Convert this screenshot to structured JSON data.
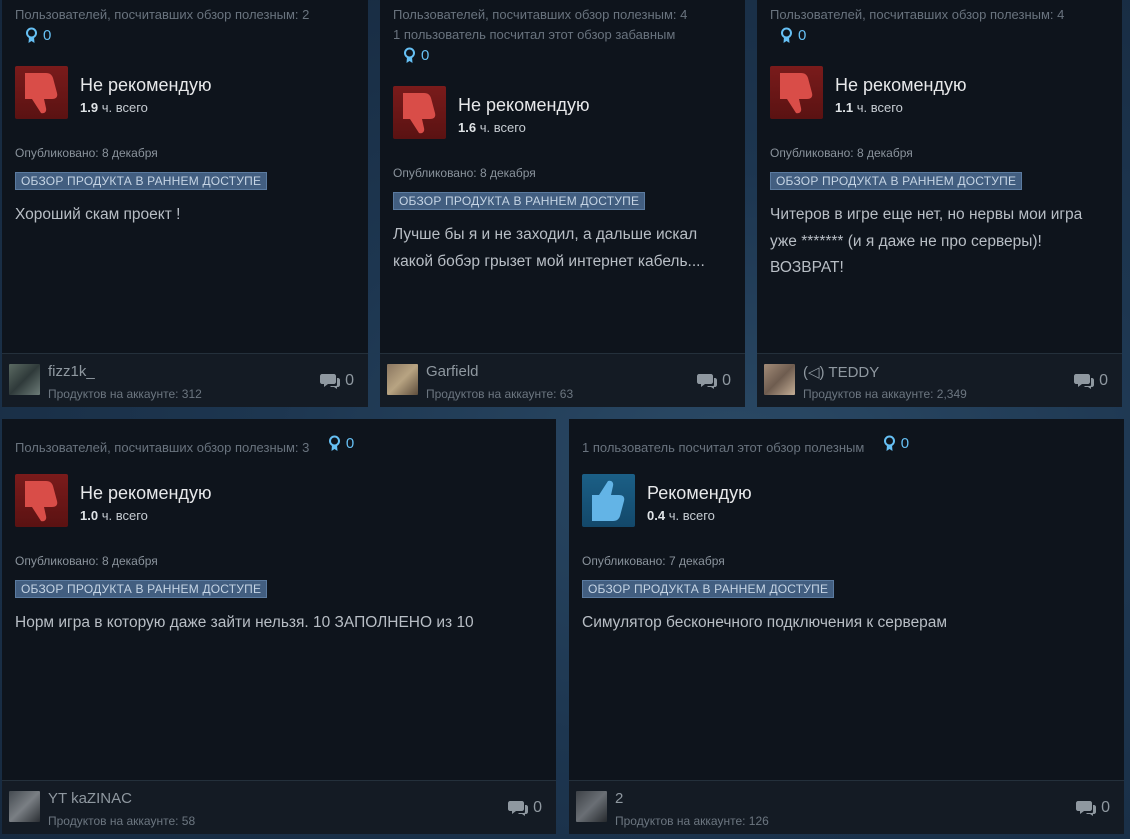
{
  "labels": {
    "posted_prefix": "Опубликовано: ",
    "hours_suffix": "ч. всего",
    "products_prefix": "Продуктов на аккаунте: ",
    "early_access": "ОБЗОР ПРОДУКТА В РАННЕМ ДОСТУПЕ"
  },
  "colors": {
    "card_bg": "#0e141c",
    "accent_blue": "#66c0f4",
    "thumb_down": "#d9534f",
    "thumb_up": "#63b4e6",
    "ea_badge": "#425e80"
  },
  "reviews": [
    {
      "helpful": "Пользователей, посчитавших обзор полезным: 2",
      "funny": "",
      "awards": "0",
      "verdict": "Не рекомендую",
      "recommended": false,
      "hours": "1.9",
      "posted": "8 декабря",
      "text": "Хороший скам проект !",
      "user": "fizz1k_",
      "products": "312",
      "comments": "0",
      "icon": "thumbs-down-icon"
    },
    {
      "helpful": "Пользователей, посчитавших обзор полезным: 4",
      "funny": "1 пользователь посчитал этот обзор забавным",
      "awards": "0",
      "verdict": "Не рекомендую",
      "recommended": false,
      "hours": "1.6",
      "posted": "8 декабря",
      "text": "Лучше бы я и не заходил, а дальше искал какой бобэр грызет мой интернет кабель....",
      "user": "Garfield",
      "products": "63",
      "comments": "0",
      "icon": "thumbs-down-icon"
    },
    {
      "helpful": "Пользователей, посчитавших обзор полезным: 4",
      "funny": "",
      "awards": "0",
      "verdict": "Не рекомендую",
      "recommended": false,
      "hours": "1.1",
      "posted": "8 декабря",
      "text": "Читеров в игре еще нет, но нервы мои игра уже ******* (и я даже не про серверы)! ВОЗВРАТ!",
      "user": "(◁) TEDDY",
      "products": "2,349",
      "comments": "0",
      "icon": "thumbs-down-icon"
    },
    {
      "helpful": "Пользователей, посчитавших обзор полезным: 3",
      "funny": "",
      "awards": "0",
      "verdict": "Не рекомендую",
      "recommended": false,
      "hours": "1.0",
      "posted": "8 декабря",
      "text": "Норм игра в которую даже зайти нельзя. 10 ЗАПОЛНЕНО из 10",
      "user": "YT kaZINAC",
      "products": "58",
      "comments": "0",
      "icon": "thumbs-down-icon"
    },
    {
      "helpful": "1 пользователь посчитал этот обзор полезным",
      "funny": "",
      "awards": "0",
      "verdict": "Рекомендую",
      "recommended": true,
      "hours": "0.4",
      "posted": "7 декабря",
      "text": "Симулятор бесконечного подключения к серверам",
      "user": "2",
      "products": "126",
      "comments": "0",
      "icon": "thumbs-up-icon"
    }
  ]
}
